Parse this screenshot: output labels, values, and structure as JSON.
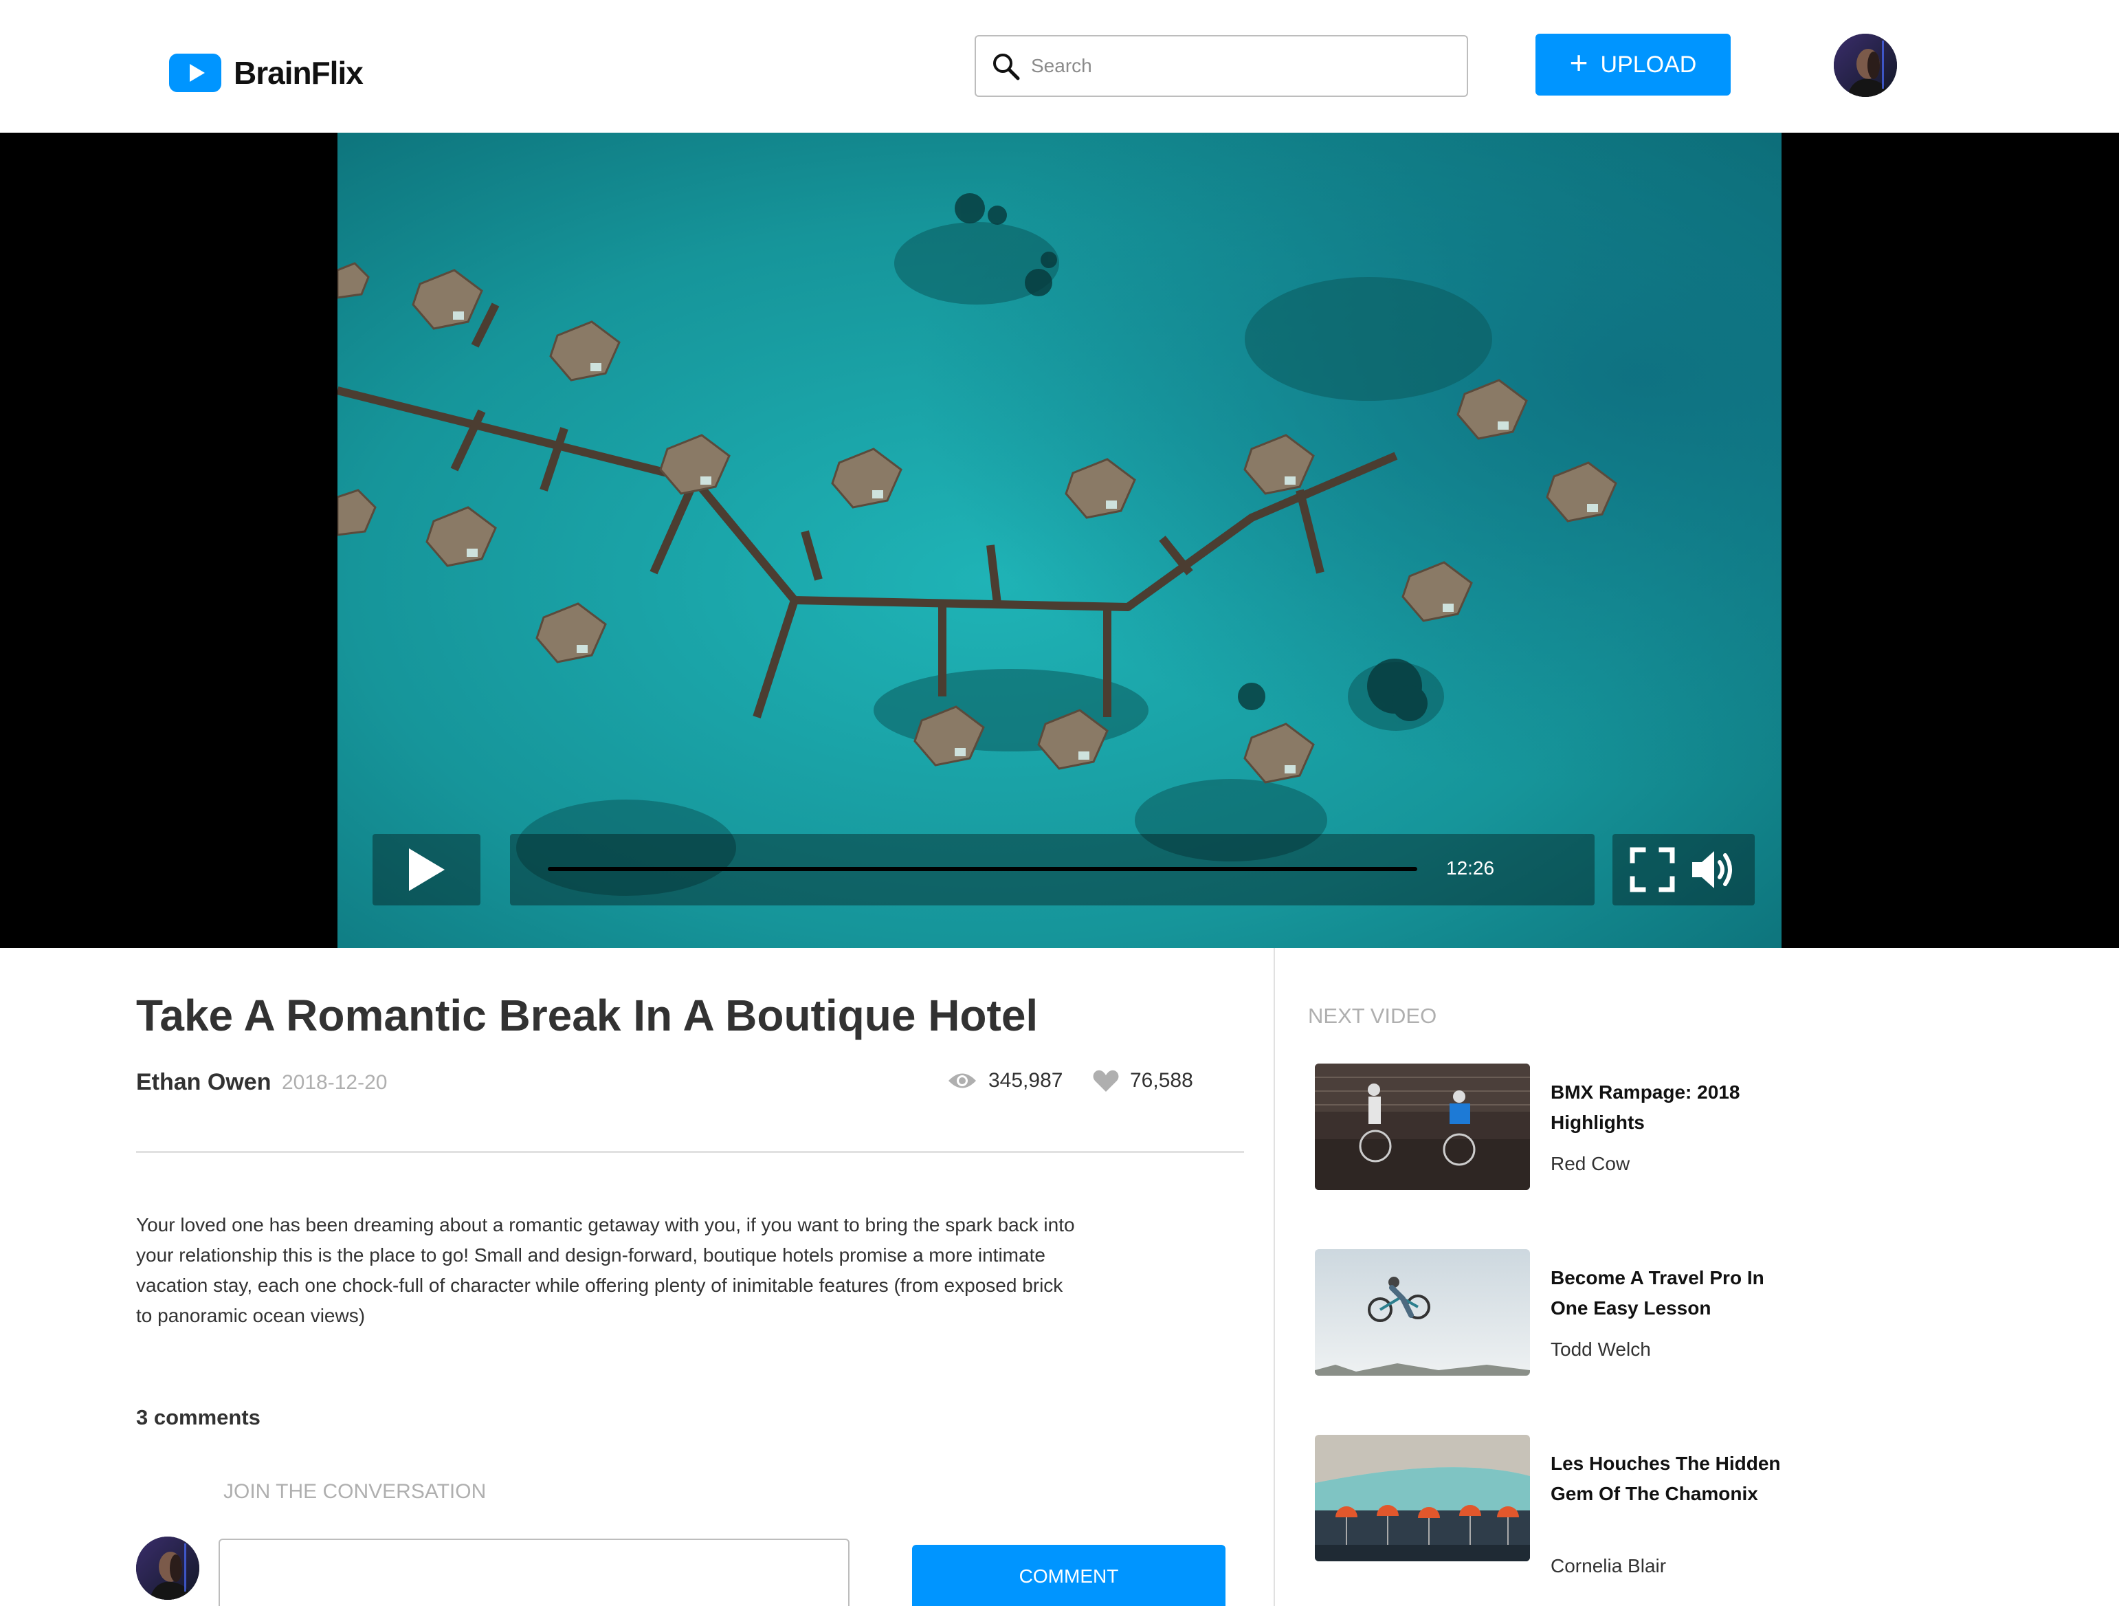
{
  "header": {
    "brand": "BrainFlix",
    "search_placeholder": "Search",
    "upload_label": "UPLOAD"
  },
  "player": {
    "duration": "12:26",
    "progress_fraction": 0
  },
  "video": {
    "title": "Take A Romantic Break In A Boutique Hotel",
    "author": "Ethan Owen",
    "date": "2018-12-20",
    "views": "345,987",
    "likes": "76,588",
    "description": "Your loved one has been dreaming about a romantic getaway with you, if you want to bring the spark back into your relationship this is the place to go! Small and design-forward, boutique hotels promise a more intimate vacation stay, each one chock-full of character while offering plenty of inimitable features (from exposed brick to panoramic ocean views)"
  },
  "comments": {
    "count_label": "3 comments",
    "join_label": "JOIN THE CONVERSATION",
    "button_label": "COMMENT"
  },
  "sidebar": {
    "heading": "NEXT VIDEO",
    "items": [
      {
        "title": "BMX Rampage: 2018 Highlights",
        "channel": "Red Cow"
      },
      {
        "title": "Become A Travel Pro In One Easy Lesson",
        "channel": "Todd Welch"
      },
      {
        "title": "Les Houches The Hidden Gem Of The Chamonix",
        "channel": "Cornelia Blair"
      }
    ]
  },
  "colors": {
    "accent": "#0095ff",
    "text": "#323232",
    "muted": "#afafaf",
    "divider": "#e1e1e1"
  },
  "icons": {
    "logo": "play-icon",
    "search": "search-icon",
    "upload": "plus-icon",
    "play": "play-icon",
    "fullscreen": "fullscreen-icon",
    "volume": "volume-icon",
    "views": "eye-icon",
    "likes": "heart-icon"
  }
}
